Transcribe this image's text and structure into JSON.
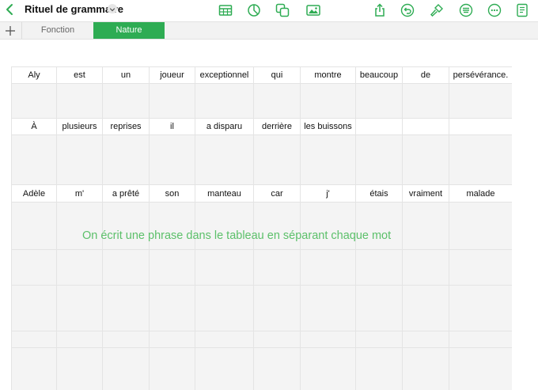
{
  "toolbar": {
    "document_title": "Rituel de grammaire",
    "icons": [
      "table-icon",
      "chart-icon",
      "shapes-icon",
      "media-icon",
      "share-icon",
      "undo-icon",
      "format-brush-icon",
      "text-format-icon",
      "more-icon",
      "document-icon"
    ],
    "accent_color": "#2eac53"
  },
  "tabs": [
    {
      "label": "Fonction",
      "active": false
    },
    {
      "label": "Nature",
      "active": true
    }
  ],
  "table": {
    "rows": [
      [
        "Aly",
        "est",
        "un",
        "joueur",
        "exceptionnel",
        "qui",
        "montre",
        "beaucoup",
        "de",
        "persévérance."
      ],
      [
        "",
        "",
        "",
        "",
        "",
        "",
        "",
        "",
        "",
        ""
      ],
      [
        "À",
        "plusieurs",
        "reprises",
        "il",
        "a disparu",
        "derrière",
        "les buissons",
        "",
        "",
        ""
      ],
      [
        "",
        "",
        "",
        "",
        "",
        "",
        "",
        "",
        "",
        ""
      ],
      [
        "Adèle",
        "m'",
        "a prêté",
        "son",
        "manteau",
        "car",
        "j'",
        "étais",
        "vraiment",
        "malade"
      ],
      [
        "",
        "",
        "",
        "",
        "",
        "",
        "",
        "",
        "",
        ""
      ],
      [
        "",
        "",
        "",
        "",
        "",
        "",
        "",
        "",
        "",
        ""
      ],
      [
        "",
        "",
        "",
        "",
        "",
        "",
        "",
        "",
        "",
        ""
      ],
      [
        "",
        "",
        "",
        "",
        "",
        "",
        "",
        "",
        "",
        ""
      ],
      [
        "",
        "",
        "",
        "",
        "",
        "",
        "",
        "",
        "",
        ""
      ]
    ]
  },
  "annotation": "On écrit une phrase dans le tableau en séparant chaque mot"
}
